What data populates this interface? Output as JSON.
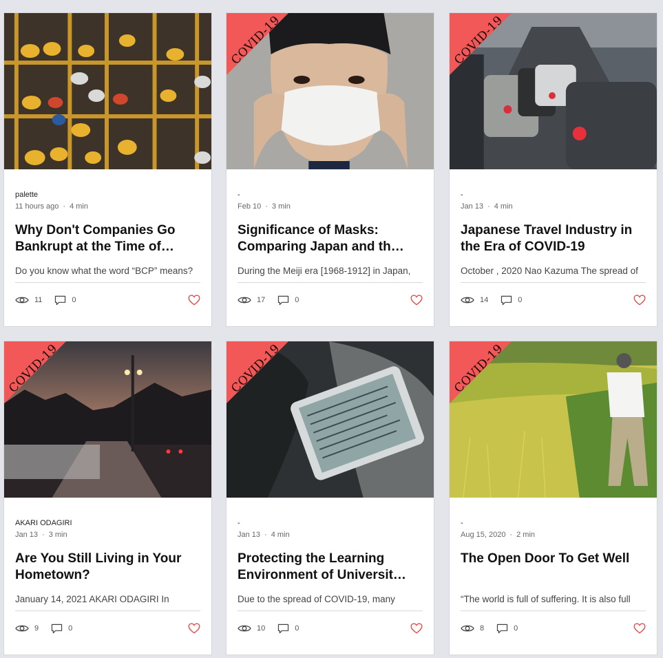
{
  "ribbon_label": "COVID-19",
  "colors": {
    "ribbon": "#f25857",
    "heart": "#e34b4b",
    "background": "#e4e5ea"
  },
  "cards": [
    {
      "has_ribbon": false,
      "author": "palette",
      "date": "11 hours ago",
      "read_time": "4 min",
      "title": "Why Don't Companies Go Bankrupt at the Time of…",
      "excerpt": "Do you know what the word “BCP” means?",
      "views": "11",
      "comments": "0",
      "image": "hardhats-shelves"
    },
    {
      "has_ribbon": true,
      "author": "-",
      "date": "Feb 10",
      "read_time": "3 min",
      "title": "Significance of Masks: Comparing Japan and th…",
      "excerpt": "During the Meiji era [1968-1912] in Japan,",
      "views": "17",
      "comments": "0",
      "image": "woman-mask"
    },
    {
      "has_ribbon": true,
      "author": "-",
      "date": "Jan 13",
      "read_time": "4 min",
      "title": "Japanese Travel Industry in the Era of COVID-19",
      "excerpt": "October , 2020 Nao Kazuma The spread of",
      "views": "14",
      "comments": "0",
      "image": "traffic-jam"
    },
    {
      "has_ribbon": true,
      "author": "AKARI ODAGIRI",
      "date": "Jan 13",
      "read_time": "3 min",
      "title": "Are You Still Living in Your Hometown?",
      "excerpt": "January 14, 2021 AKARI ODAGIRI In",
      "views": "9",
      "comments": "0",
      "image": "bridge-dusk"
    },
    {
      "has_ribbon": true,
      "author": "-",
      "date": "Jan 13",
      "read_time": "4 min",
      "title": "Protecting the Learning Environment of Universit…",
      "excerpt": "Due to the spread of COVID-19, many",
      "views": "10",
      "comments": "0",
      "image": "tablet-reading"
    },
    {
      "has_ribbon": true,
      "author": "-",
      "date": "Aug 15, 2020",
      "read_time": "2 min",
      "title": "The Open Door To Get Well",
      "excerpt": "“The world is full of suffering. It is also full",
      "views": "8",
      "comments": "0",
      "image": "field-walker"
    }
  ]
}
